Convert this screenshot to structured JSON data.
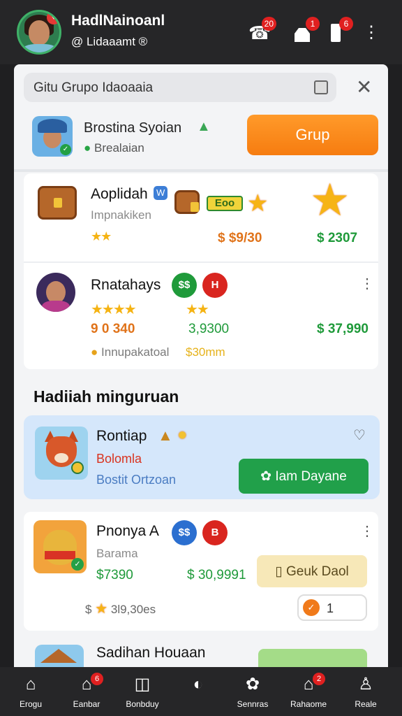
{
  "header": {
    "user_name": "HadlNainoanl",
    "user_sub": "@ Lidaaamt ®",
    "notif_call_badge": "20",
    "notif_profile_badge": "1",
    "notif_phone_badge": "6"
  },
  "search": {
    "value": "Gitu Grupo Idaoaaia"
  },
  "group": {
    "name": "Brostina Syoian",
    "status": "Brealaian",
    "button_label": "Grup"
  },
  "rows": [
    {
      "name": "Aoplidah",
      "tag_label": "W",
      "chip_label": "Eoo",
      "subtitle": "Impnakiken",
      "stars": "★★",
      "price_mid": "$ $9/30",
      "price_right": "$ 2307"
    },
    {
      "name": "Rnatahays",
      "chip1_label": "$$",
      "chip2_label": "H",
      "stars_left": "★★★★",
      "stars_right": "★★",
      "val_left": "9 0 340",
      "val_mid": "3,9300",
      "val_right": "$ 37,990",
      "note": "Innupakatoal",
      "note_amount": "$30mm"
    }
  ],
  "section": {
    "title": "Hadiiah minguruan"
  },
  "featured": {
    "name": "Rontiap",
    "sub_red": "Bolomla",
    "sub_blue": "Bostit Ortzoan",
    "button_label": "Iam Dayane"
  },
  "row3": {
    "name": "Pnonya A",
    "chip1_label": "$$",
    "chip2_label": "B",
    "subtitle": "Barama",
    "price_left": "$7390",
    "price_mid": "$ 30,9991",
    "button_label": "Geuk Daol",
    "bottom_stars_value": "3l9,30es",
    "stepper_value": "1"
  },
  "row4": {
    "name": "Sadihan Houaan"
  },
  "nav": [
    {
      "label": "Erogu"
    },
    {
      "label": "Eanbar",
      "badge": "6"
    },
    {
      "label": "Bonbduy"
    },
    {
      "label": ""
    },
    {
      "label": "Sennras"
    },
    {
      "label": "Rahaome",
      "badge": "2"
    },
    {
      "label": "Reale"
    }
  ],
  "colors": {
    "accent_orange": "#f67c10",
    "accent_green": "#21a04a",
    "badge_red": "#e02020",
    "highlight_blue": "#d5e7fb"
  },
  "icons": {
    "header": [
      "phone-icon",
      "profile-icon",
      "phone-device-icon",
      "more-vertical-icon"
    ],
    "nav": [
      "home-icon",
      "shop-icon",
      "message-icon",
      "compass-icon",
      "settings-icon",
      "notification-icon",
      "profile-icon"
    ]
  }
}
